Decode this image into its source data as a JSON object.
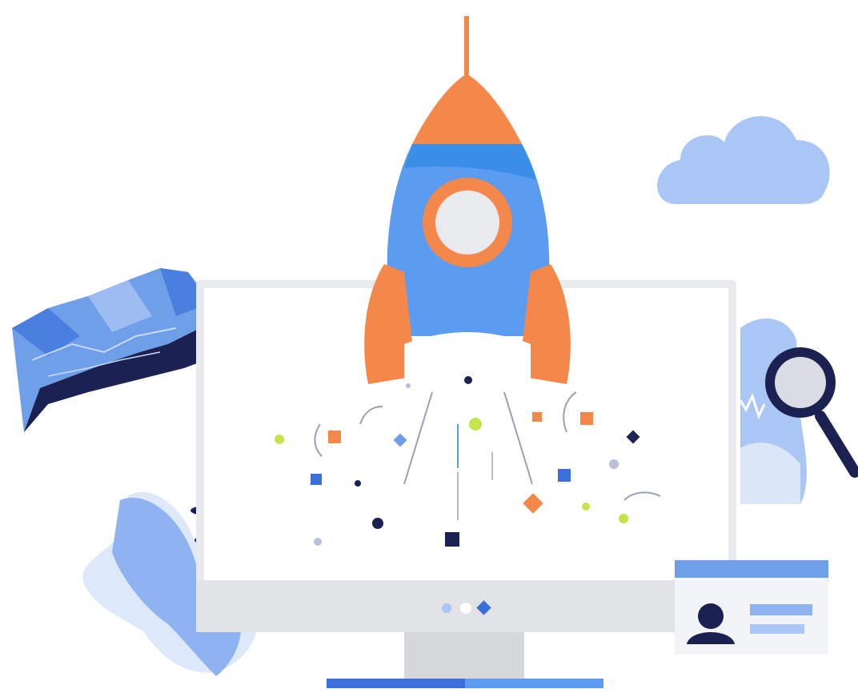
{
  "illustration": {
    "palette": {
      "blue_light": "#a9c6f5",
      "blue_mid": "#5b9cf0",
      "blue_deep": "#3a6fdc",
      "navy": "#1b2150",
      "orange": "#f4884b",
      "lime": "#c4e44a",
      "gray_light": "#e9eaed",
      "gray_mid": "#d5d7db",
      "white": "#ffffff"
    },
    "icons": [
      "rocket-icon",
      "cloud-icon",
      "map-icon",
      "magnifying-glass-icon",
      "monitor-icon",
      "profile-card-icon",
      "leaf-icon",
      "confetti-icon"
    ],
    "monitor": {
      "carousel_dots": 3,
      "active_dot": 3
    },
    "progress_bar": {
      "fill_fraction": 0.5
    }
  }
}
